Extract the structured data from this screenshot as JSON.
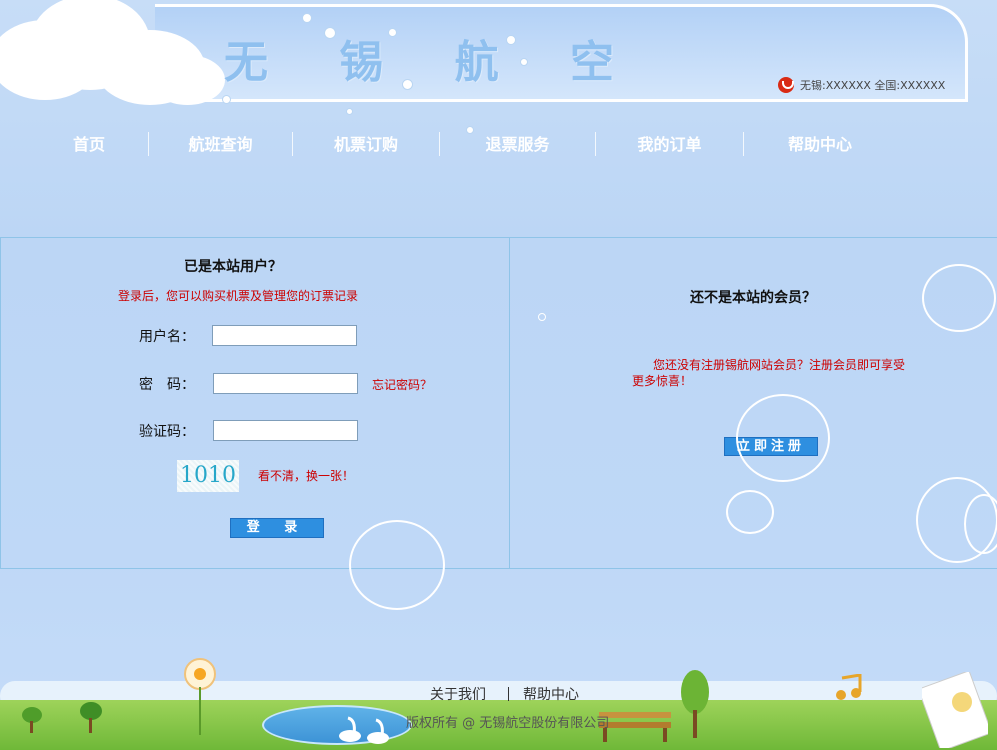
{
  "header": {
    "logo": "无 锡 航 空",
    "hotline": "无锡:XXXXXX  全国:XXXXXX"
  },
  "nav": [
    {
      "label": "首页"
    },
    {
      "label": "航班查询"
    },
    {
      "label": "机票订购"
    },
    {
      "label": "退票服务"
    },
    {
      "label": "我的订单"
    },
    {
      "label": "帮助中心"
    }
  ],
  "login": {
    "title": "已是本站用户？",
    "hint": "登录后，您可以购买机票及管理您的订票记录",
    "username_label": "用户名：",
    "password_label": "密　码：",
    "captcha_label": "验证码：",
    "username_value": "",
    "password_value": "",
    "captcha_value": "",
    "forgot_password": "忘记密码？",
    "captcha_image_text": "1010",
    "refresh_captcha": "看不清，换一张！",
    "submit": "登 录"
  },
  "register": {
    "title": "还不是本站的会员？",
    "hint": "您还没有注册锡航网站会员？注册会员即可享受更多惊喜！",
    "submit": "立即注册"
  },
  "footer": {
    "links": [
      "关于我们",
      "帮助中心"
    ],
    "copyright": "版权所有 @ 无锡航空股份有限公司"
  }
}
